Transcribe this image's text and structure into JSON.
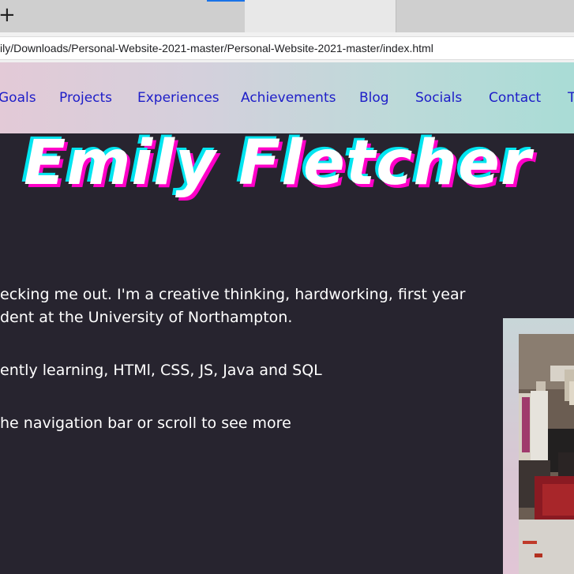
{
  "browser": {
    "new_tab_glyph": "+",
    "url": "ily/Downloads/Personal-Website-2021-master/Personal-Website-2021-master/index.html"
  },
  "nav": {
    "items": [
      "Goals",
      "Projects",
      "Experiences",
      "Achievements",
      "Blog",
      "Socials",
      "Contact",
      "T"
    ]
  },
  "hero": {
    "name": "Emily Fletcher"
  },
  "intro": {
    "line1": "ecking me out. I'm a creative thinking, hardworking, first year",
    "line2": "dent at the University of Northampton.",
    "line3": "ently learning, HTMl, CSS, JS, Java and SQL",
    "line4": "he navigation bar or scroll to see more"
  },
  "colors": {
    "background": "#27242f",
    "nav_link": "#1d1dc8",
    "name_shadow_cyan": "#00e5f0",
    "name_shadow_magenta": "#ff00c8"
  }
}
